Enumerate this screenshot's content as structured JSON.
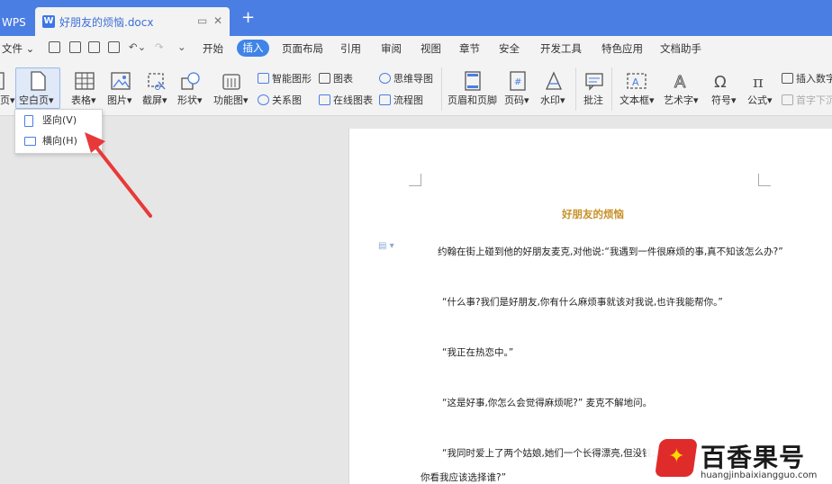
{
  "titlebar": {
    "wps_tab": "WPS",
    "doc_tab": "好朋友的烦恼.docx",
    "new_tab": "+"
  },
  "menubar": {
    "file": "文件",
    "items": [
      "开始",
      "插入",
      "页面布局",
      "引用",
      "审阅",
      "视图",
      "章节",
      "安全",
      "开发工具",
      "特色应用",
      "文档助手"
    ],
    "active": "插入"
  },
  "ribbon": {
    "blank_page": "空白页",
    "table": "表格",
    "picture": "图片",
    "screenshot": "截屏",
    "shape": "形状",
    "function_chart": "功能图",
    "smart_shape": "智能图形",
    "chart": "图表",
    "mind_map": "思维导图",
    "relation_chart": "关系图",
    "online_chart": "在线图表",
    "flowchart": "流程图",
    "header_footer": "页眉和页脚",
    "page_number": "页码",
    "watermark": "水印",
    "comment": "批注",
    "textbox": "文本框",
    "wordart": "艺术字",
    "symbol": "符号",
    "formula": "公式",
    "insert_number": "插入数字",
    "drop_cap": "首字下沉"
  },
  "dropdown": {
    "portrait": "竖向(V)",
    "landscape": "横向(H)"
  },
  "document": {
    "title": "好朋友的烦恼",
    "paragraphs": [
      "约翰在街上碰到他的好朋友麦克,对他说:“我遇到一件很麻烦的事,真不知该怎么办?”",
      "“什么事?我们是好朋友,你有什么麻烦事就该对我说,也许我能帮你。”",
      "“我正在热恋中。”",
      "“这是好事,你怎么会觉得麻烦呢?” 麦克不解地问。",
      "“我同时爱上了两个姑娘,她们一个长得漂亮,但没钱;",
      "你看我应该选择谁?”"
    ]
  },
  "watermark": {
    "brand": "百香果号",
    "url": "huangjinbaixiangguo.com"
  },
  "colors": {
    "titlebar": "#4a7ee3",
    "accent": "#3f84e8",
    "doc_title": "#c8912a",
    "arrow": "#e8393a"
  }
}
